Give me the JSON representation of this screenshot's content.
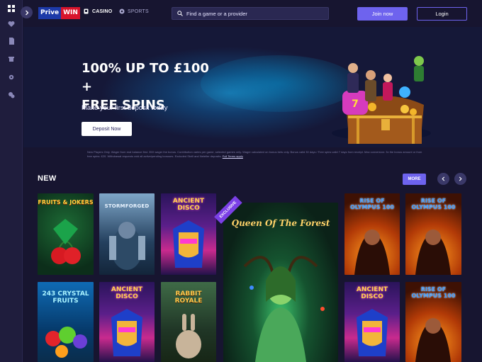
{
  "header": {
    "logo_left": "Prive",
    "logo_right": "WIN",
    "nav_casino": "CASINO",
    "nav_sports": "SPORTS",
    "search_placeholder": "Find a game or a provider",
    "join_label": "Join now",
    "login_label": "Login"
  },
  "sidebar": {
    "icons": [
      "grid-icon",
      "heart-icon",
      "document-icon",
      "gift-icon",
      "gear-icon",
      "chat-icon"
    ]
  },
  "hero": {
    "title_line1": "100% UP TO £100 +",
    "title_line2": "FREE SPINS",
    "subtitle": "Make your first deposit today",
    "button_label": "Deposit Now"
  },
  "terms": {
    "text": "New Players Only. Wager from real balance first. 35X wager the bonus. Contribution varies per game, selected games only. Wager calculated on bonus bets only. Bonus valid 30 days / Free spins valid 7 days from receipt. Max conversion: 3x the bonus amount or from free spins: £20. Withdrawal requests void all active/pending bonuses. Excluded Skrill and Neteller deposits.",
    "link_label": "Full Terms apply"
  },
  "new_section": {
    "title": "NEW",
    "more_label": "MORE",
    "exclusive_badge": "EXCLUSIVE",
    "games": [
      {
        "name": "Fruits & Jokers",
        "title": "FRUITS & JOKERS"
      },
      {
        "name": "Stormforged",
        "title": "STORMFORGED"
      },
      {
        "name": "Ancient Disco",
        "title": "ANCIENT DISCO"
      },
      {
        "name": "Queen of the Forest",
        "title": "Queen Of The Forest"
      },
      {
        "name": "Rise of Olympus 100",
        "title": "RISE OF OLYMPUS 100"
      },
      {
        "name": "Rise of Olympus 100",
        "title": "RISE OF OLYMPUS 100"
      },
      {
        "name": "243 Crystal Fruits",
        "title": "243 CRYSTAL FRUITS"
      },
      {
        "name": "Ancient Disco",
        "title": "ANCIENT DISCO"
      },
      {
        "name": "Rabbit Royale",
        "title": "RABBIT ROYALE"
      },
      {
        "name": "Ancient Disco",
        "title": "ANCIENT DISCO"
      },
      {
        "name": "Rise of Olympus 100",
        "title": "RISE OF OLYMPUS 100"
      }
    ]
  }
}
